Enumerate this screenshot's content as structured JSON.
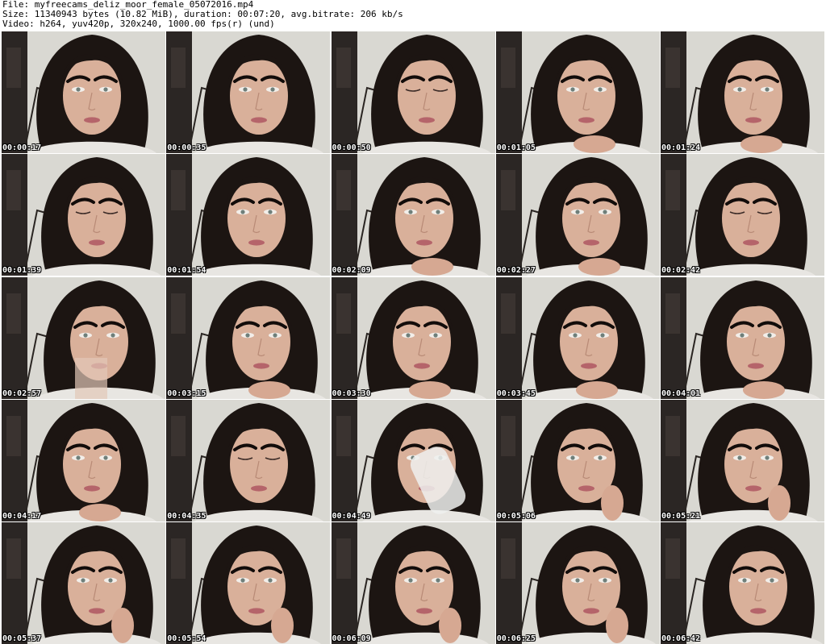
{
  "header": {
    "file_line": "File: myfreecams_deliz_moor_female_05072016.mp4",
    "size_line": "Size: 11340943 bytes (10.82 MiB), duration: 00:07:20, avg.bitrate: 206 kb/s",
    "video_line": "Video: h264, yuv420p, 320x240, 1000.00 fps(r) (und)"
  },
  "colors": {
    "wall": "#d9d8d2",
    "door": "#2b2624",
    "hair": "#1c1512",
    "skin": "#d9b09a",
    "brow": "#120c0a",
    "lips": "#b5646a",
    "shirt": "#e8e6e2"
  },
  "frames": [
    {
      "timestamp": "00:00:17",
      "variant": "neutral"
    },
    {
      "timestamp": "00:00:35",
      "variant": "neutral"
    },
    {
      "timestamp": "00:00:50",
      "variant": "eyes-down"
    },
    {
      "timestamp": "00:01:05",
      "variant": "hands-chin"
    },
    {
      "timestamp": "00:01:24",
      "variant": "hands-chin"
    },
    {
      "timestamp": "00:01:39",
      "variant": "eyes-down"
    },
    {
      "timestamp": "00:01:54",
      "variant": "neutral"
    },
    {
      "timestamp": "00:02:09",
      "variant": "hand-chin"
    },
    {
      "timestamp": "00:02:27",
      "variant": "hand-chin"
    },
    {
      "timestamp": "00:02:42",
      "variant": "eyes-down"
    },
    {
      "timestamp": "00:02:57",
      "variant": "tilted-blur"
    },
    {
      "timestamp": "00:03:15",
      "variant": "hand-chin"
    },
    {
      "timestamp": "00:03:30",
      "variant": "hand-chin"
    },
    {
      "timestamp": "00:03:45",
      "variant": "hand-chin"
    },
    {
      "timestamp": "00:04:01",
      "variant": "hand-chin"
    },
    {
      "timestamp": "00:04:17",
      "variant": "hand-chin"
    },
    {
      "timestamp": "00:04:35",
      "variant": "eyes-down"
    },
    {
      "timestamp": "00:04:49",
      "variant": "drinking"
    },
    {
      "timestamp": "00:05:06",
      "variant": "hand-cheek"
    },
    {
      "timestamp": "00:05:21",
      "variant": "hand-cheek"
    },
    {
      "timestamp": "00:05:37",
      "variant": "hand-cheek"
    },
    {
      "timestamp": "00:05:54",
      "variant": "hand-cheek"
    },
    {
      "timestamp": "00:06:09",
      "variant": "hand-cheek"
    },
    {
      "timestamp": "00:06:25",
      "variant": "hand-cheek"
    },
    {
      "timestamp": "00:06:42",
      "variant": "tilted"
    }
  ]
}
